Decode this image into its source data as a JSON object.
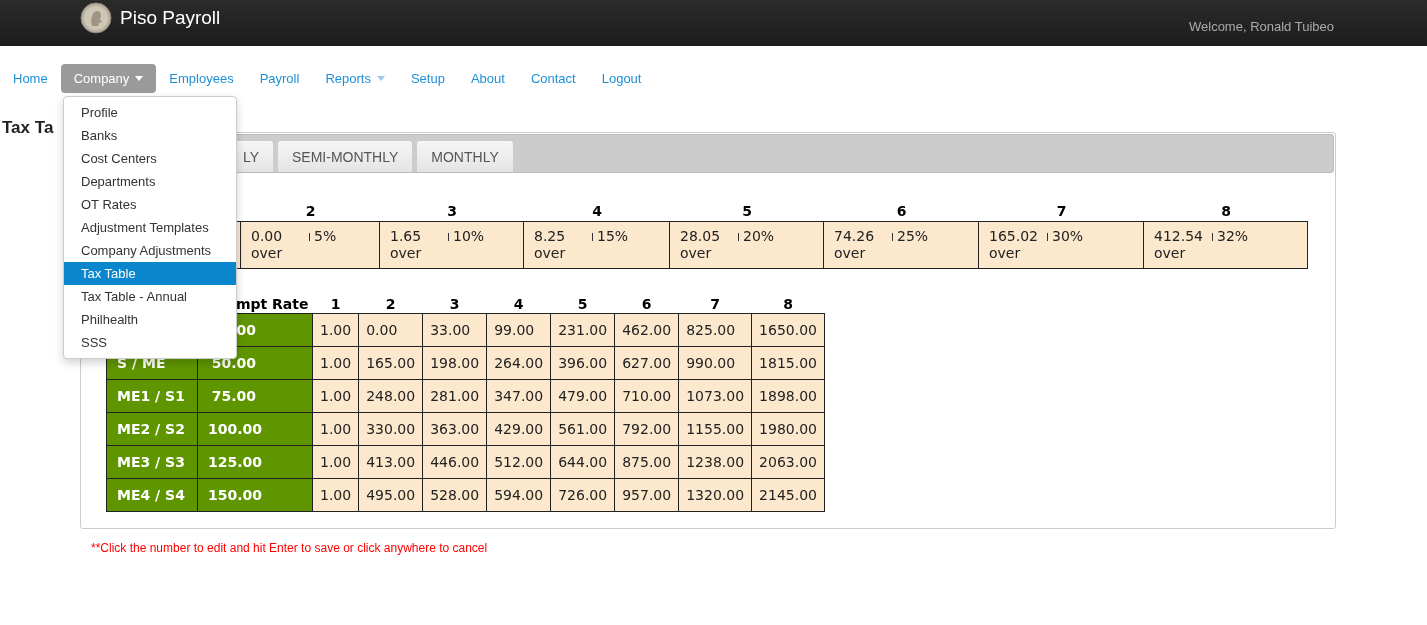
{
  "brand": {
    "title": "Piso Payroll",
    "welcome": "Welcome, Ronald Tuibeo"
  },
  "nav": [
    {
      "label": "Home",
      "selected": false,
      "dropdown": false
    },
    {
      "label": "Company",
      "selected": true,
      "dropdown": true
    },
    {
      "label": "Employees",
      "selected": false,
      "dropdown": false
    },
    {
      "label": "Payroll",
      "selected": false,
      "dropdown": false
    },
    {
      "label": "Reports",
      "selected": false,
      "dropdown": true
    },
    {
      "label": "Setup",
      "selected": false,
      "dropdown": false
    },
    {
      "label": "About",
      "selected": false,
      "dropdown": false
    },
    {
      "label": "Contact",
      "selected": false,
      "dropdown": false
    },
    {
      "label": "Logout",
      "selected": false,
      "dropdown": false
    }
  ],
  "dropdown_menu": [
    {
      "label": "Profile",
      "selected": false
    },
    {
      "label": "Banks",
      "selected": false
    },
    {
      "label": "Cost Centers",
      "selected": false
    },
    {
      "label": "Departments",
      "selected": false
    },
    {
      "label": "OT Rates",
      "selected": false
    },
    {
      "label": "Adjustment Templates",
      "selected": false
    },
    {
      "label": "Company Adjustments",
      "selected": false
    },
    {
      "label": "Tax Table",
      "selected": true
    },
    {
      "label": "Tax Table - Annual",
      "selected": false
    },
    {
      "label": "Philhealth",
      "selected": false
    },
    {
      "label": "SSS",
      "selected": false
    }
  ],
  "page_title": "Tax Ta",
  "tabs": [
    "LY",
    "SEMI-MONTHLY",
    "MONTHLY"
  ],
  "brackets": [
    {
      "header": "2",
      "amount": "0.00",
      "rate": "5%",
      "over": "over"
    },
    {
      "header": "3",
      "amount": "1.65",
      "rate": "10%",
      "over": "over"
    },
    {
      "header": "4",
      "amount": "8.25",
      "rate": "15%",
      "over": "over"
    },
    {
      "header": "5",
      "amount": "28.05",
      "rate": "20%",
      "over": "over"
    },
    {
      "header": "6",
      "amount": "74.26",
      "rate": "25%",
      "over": "over"
    },
    {
      "header": "7",
      "amount": "165.02",
      "rate": "30%",
      "over": "over"
    },
    {
      "header": "8",
      "amount": "412.54",
      "rate": "32%",
      "over": "over"
    }
  ],
  "table": {
    "columns": [
      "mpt Rate",
      "1",
      "2",
      "3",
      "4",
      "5",
      "6",
      "7",
      "8"
    ],
    "rows": [
      {
        "exempt": "00",
        "values": [
          "1.00",
          "0.00",
          "33.00",
          "99.00",
          "231.00",
          "462.00",
          "825.00",
          "1650.00"
        ]
      },
      {
        "status": "S / ME",
        "exempt": "50.00",
        "values": [
          "1.00",
          "165.00",
          "198.00",
          "264.00",
          "396.00",
          "627.00",
          "990.00",
          "1815.00"
        ]
      },
      {
        "status": "ME1 / S1",
        "exempt": "75.00",
        "values": [
          "1.00",
          "248.00",
          "281.00",
          "347.00",
          "479.00",
          "710.00",
          "1073.00",
          "1898.00"
        ]
      },
      {
        "status": "ME2 / S2",
        "exempt": "100.00",
        "values": [
          "1.00",
          "330.00",
          "363.00",
          "429.00",
          "561.00",
          "792.00",
          "1155.00",
          "1980.00"
        ]
      },
      {
        "status": "ME3 / S3",
        "exempt": "125.00",
        "values": [
          "1.00",
          "413.00",
          "446.00",
          "512.00",
          "644.00",
          "875.00",
          "1238.00",
          "2063.00"
        ]
      },
      {
        "status": "ME4 / S4",
        "exempt": "150.00",
        "values": [
          "1.00",
          "495.00",
          "528.00",
          "594.00",
          "726.00",
          "957.00",
          "1320.00",
          "2145.00"
        ]
      }
    ]
  },
  "note": "**Click the number to edit and hit Enter to save or click anywhere to cancel"
}
